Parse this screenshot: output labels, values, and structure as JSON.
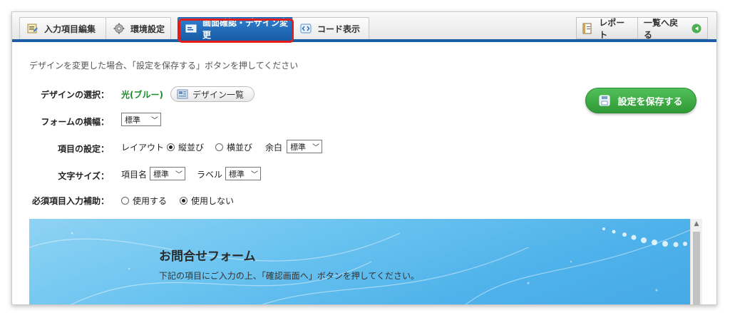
{
  "tabs": [
    {
      "label": "入力項目編集",
      "icon": "form-edit-icon"
    },
    {
      "label": "環境設定",
      "icon": "gear-icon"
    },
    {
      "label": "画面確認・デザイン変更",
      "icon": "screen-design-icon"
    },
    {
      "label": "コード表示",
      "icon": "code-icon"
    }
  ],
  "right_tabs": [
    {
      "label": "レポート",
      "icon": "report-icon"
    },
    {
      "label": "一覧へ戻る",
      "icon": "back-arrow-icon"
    }
  ],
  "hint": "デザインを変更した場合、「設定を保存する」ボタンを押してください",
  "design": {
    "label": "デザインの選択：",
    "value": "光(ブルー)",
    "list_button": "デザイン一覧"
  },
  "form_width": {
    "label": "フォームの横幅：",
    "value": "標準"
  },
  "item_setting": {
    "label": "項目の設定：",
    "layout_label": "レイアウト",
    "option_vertical": "縦並び",
    "option_horizontal": "横並び",
    "selected": "縦並び",
    "margin_label": "余白",
    "margin_value": "標準"
  },
  "font_size": {
    "label": "文字サイズ：",
    "item_name_label": "項目名",
    "item_name_value": "標準",
    "field_label": "ラベル",
    "field_value": "標準"
  },
  "required_assist": {
    "label": "必須項目入力補助：",
    "option_use": "使用する",
    "option_nouse": "使用しない",
    "selected": "使用しない"
  },
  "save_button": "設定を保存する",
  "preview": {
    "title": "お問合せフォーム",
    "subtitle": "下記の項目にご入力の上、「確認画面へ」ボタンを押してください。"
  },
  "colors": {
    "accent_blue": "#1a5ea8",
    "save_green": "#3aa840",
    "highlight_red": "#e21b1b",
    "value_green": "#1a8a2a"
  }
}
